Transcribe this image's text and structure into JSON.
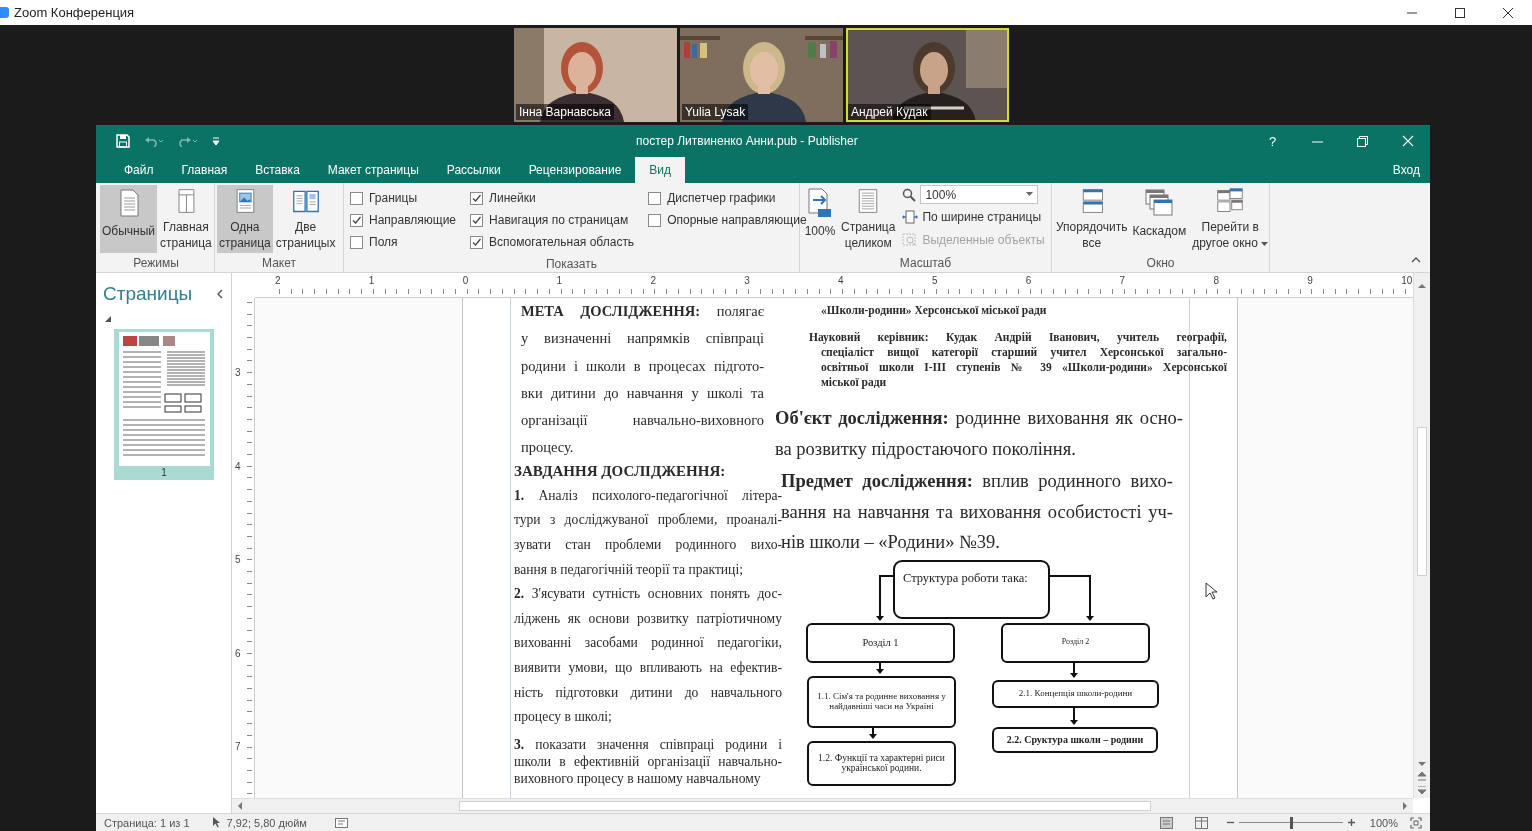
{
  "zoom_window": {
    "title": "Zoom Конференция"
  },
  "participants": [
    {
      "name": "Інна Варнавська",
      "speaking": false
    },
    {
      "name": "Yulia Lysak",
      "speaking": false
    },
    {
      "name": "Андрей Кудак",
      "speaking": true
    }
  ],
  "publisher": {
    "title": "постер Литвиненко Анни.pub - Publisher",
    "help": "?",
    "sign_in": "Вход",
    "tabs": [
      {
        "label": "Файл",
        "selected": false
      },
      {
        "label": "Главная",
        "selected": false
      },
      {
        "label": "Вставка",
        "selected": false
      },
      {
        "label": "Макет страницы",
        "selected": false
      },
      {
        "label": "Рассылки",
        "selected": false
      },
      {
        "label": "Рецензирование",
        "selected": false
      },
      {
        "label": "Вид",
        "selected": true
      }
    ],
    "ribbon_groups": [
      {
        "label": "Режимы",
        "items": [
          {
            "kind": "toggle",
            "label": "Обычный",
            "selected": true
          },
          {
            "kind": "toggle",
            "label": "Главная страница",
            "selected": false
          }
        ]
      },
      {
        "label": "Макет",
        "items": [
          {
            "kind": "toggle",
            "label": "Одна страница",
            "selected": true
          },
          {
            "kind": "toggle",
            "label": "Две страницых",
            "selected": false
          }
        ]
      },
      {
        "label": "Показать",
        "items": [
          {
            "kind": "check",
            "label": "Границы",
            "checked": false
          },
          {
            "kind": "check",
            "label": "Направляющие",
            "checked": true
          },
          {
            "kind": "check",
            "label": "Поля",
            "checked": false
          },
          {
            "kind": "check",
            "label": "Линейки",
            "checked": true
          },
          {
            "kind": "check",
            "label": "Навигация по страницам",
            "checked": true
          },
          {
            "kind": "check",
            "label": "Вспомогательная область",
            "checked": true
          },
          {
            "kind": "check",
            "label": "Диспетчер графики",
            "checked": false
          },
          {
            "kind": "check",
            "label": "Опорные направляющие",
            "checked": false
          }
        ]
      },
      {
        "label": "Масштаб",
        "items": [
          {
            "kind": "big",
            "label": "100%",
            "dropdown": false
          },
          {
            "kind": "big",
            "label": "Страница целиком",
            "dropdown": false
          },
          {
            "kind": "zoom",
            "value": "100%"
          },
          {
            "kind": "small",
            "label": "По ширине страницы",
            "disabled": false
          },
          {
            "kind": "small",
            "label": "Выделенные объекты",
            "disabled": true
          }
        ]
      },
      {
        "label": "Окно",
        "items": [
          {
            "kind": "big",
            "label": "Упорядочить все",
            "dropdown": false
          },
          {
            "kind": "big",
            "label": "Каскадом",
            "dropdown": false
          },
          {
            "kind": "big",
            "label": "Перейти в другое окно",
            "dropdown": true
          }
        ]
      }
    ]
  },
  "pages_pane": {
    "title": "Страницы",
    "pages": [
      {
        "number": "1",
        "selected": true
      }
    ]
  },
  "rulers": {
    "horizontal": [
      "2",
      "1",
      "0",
      "1",
      "2",
      "3",
      "4",
      "5",
      "6",
      "7",
      "8",
      "9",
      "10"
    ],
    "vertical": [
      "3",
      "4",
      "5",
      "6",
      "7"
    ]
  },
  "document": {
    "goal": {
      "lines": [
        "**МЕТА ДОСЛІДЖЕННЯ:** полягає",
        "у визначенні напрямків співпраці",
        "родини і школи в процесах підгото-",
        "вки дитини до навчання у школі та",
        "організації навчально-виховного",
        "процесу."
      ]
    },
    "tasks_heading": "ЗАВДАННЯ ДОСЛІДЖЕННЯ:",
    "tasks": [
      {
        "lines": [
          "**1.** Аналіз психолого-педагогічної літера-",
          "тури з досліджуваної проблеми, проаналі-",
          "зувати стан проблеми родинного вихо-",
          "вання в педагогічній теорії та практиці;"
        ]
      },
      {
        "lines": [
          "**2.** З'ясувати сутність основних понять дос-",
          "ліджень як основи розвитку патріотичному",
          "вихованні засобами родинної педагогіки,",
          "виявити умови, що впливають на ефектив-",
          "ність підготовки дитини до навчального",
          "процесу в школі;"
        ]
      },
      {
        "lines": [
          "**3.** показати значення співпраці родини і",
          "школи в ефективній організації навчально-",
          "виховного процесу в нашому навчальному"
        ]
      }
    ],
    "author_school": "«Школи-родини» Херсонської міської ради",
    "adviser": {
      "lines": [
        "Науковий керівник: Кудак Андрій Іванович, учитель географії,",
        "спеціаліст вищої категорії старший учител Херсонської загально-",
        "освітньої школи І-ІІІ ступенів № 39 «Школи-родини» Херсонської",
        "міської ради"
      ]
    },
    "object": {
      "lines": [
        "**Об'єкт дослідження:** родинне виховання як осно-",
        "ва розвитку підростаючого покоління."
      ]
    },
    "subject": {
      "lines": [
        "**Предмет дослідження:** вплив родинного вихо-",
        "вання на навчання та виховання особистості уч-",
        "нів школи – «Родини» №39."
      ]
    },
    "diagram": {
      "nodes": [
        {
          "text": "Структура роботи така:",
          "bold": false
        },
        {
          "text": "Розділ 1",
          "bold": false
        },
        {
          "text": "Розділ 2",
          "bold": false
        },
        {
          "text": "1.1. Сім'я та родинне виховання у найдавніші часи на Україні",
          "bold": false
        },
        {
          "text": "1.2. Функції та характерні риси української родини.",
          "bold": false
        },
        {
          "text": "2.1. Концепція школи-родини",
          "bold": false
        },
        {
          "text": "2.2. Сруктура школи – родини",
          "bold": true
        }
      ]
    }
  },
  "status_bar": {
    "page": "Страница: 1 из 1",
    "position": "7,92; 5,80 дюйм",
    "zoom": {
      "level": 0.5,
      "reading": "100%"
    }
  }
}
